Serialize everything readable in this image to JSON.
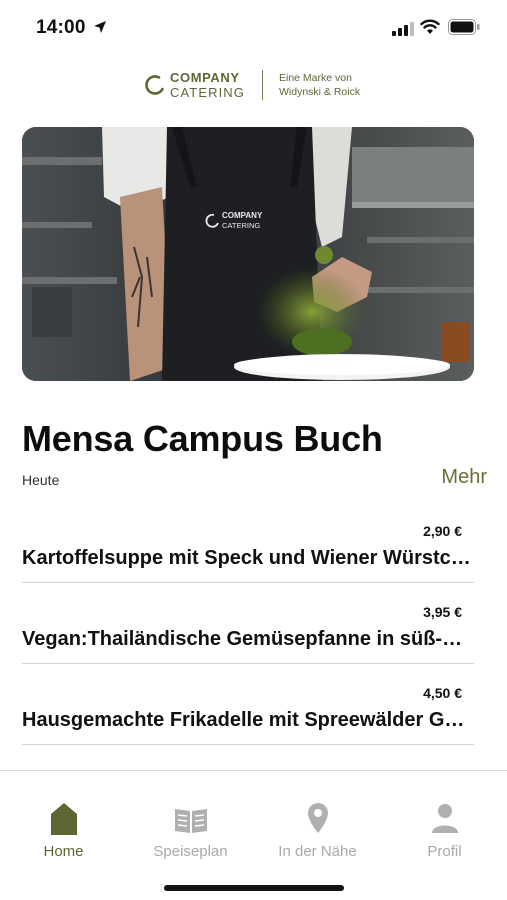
{
  "status_bar": {
    "time": "14:00",
    "icons": [
      "location-arrow-icon",
      "signal-icon",
      "wifi-icon",
      "battery-icon"
    ]
  },
  "brand": {
    "line1": "COMPANY",
    "line2": "CATERING",
    "tagline1": "Eine Marke von",
    "tagline2": "Widynski & Roick",
    "color": "#5e6634"
  },
  "hero": {
    "apron_line1": "COMPANY",
    "apron_line2": "CATERING"
  },
  "canteen": {
    "title": "Mensa Campus Buch",
    "day": "Heute",
    "more_label": "Mehr"
  },
  "meals": [
    {
      "price": "2,90 €",
      "name": "Kartoffelsuppe mit Speck und Wiener Würstchen"
    },
    {
      "price": "3,95 €",
      "name": "Vegan:Thailändische Gemüsepfanne in süß-saurer Sauce"
    },
    {
      "price": "4,50 €",
      "name": "Hausgemachte Frikadelle mit Spreewälder Gurken"
    }
  ],
  "tabs": [
    {
      "label": "Home",
      "icon": "home-icon",
      "active": true
    },
    {
      "label": "Speiseplan",
      "icon": "book-icon",
      "active": false
    },
    {
      "label": "In der Nähe",
      "icon": "location-pin-icon",
      "active": false
    },
    {
      "label": "Profil",
      "icon": "person-icon",
      "active": false
    }
  ],
  "colors": {
    "accent": "#5e6634",
    "inactive": "#a9a9a9"
  }
}
